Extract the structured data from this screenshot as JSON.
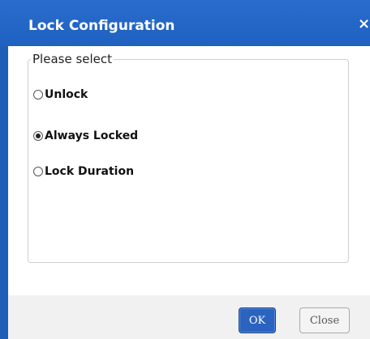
{
  "dialog": {
    "title": "Lock Configuration",
    "close_glyph": "×"
  },
  "group": {
    "legend": "Please select",
    "options": [
      {
        "label": "Unlock",
        "selected": false
      },
      {
        "label": "Always Locked",
        "selected": true
      },
      {
        "label": "Lock Duration",
        "selected": false
      }
    ]
  },
  "buttons": {
    "ok_label": "OK",
    "close_label": "Close"
  },
  "colors": {
    "titlebar": "#1f61c0",
    "ok_button": "#2a63c0"
  }
}
